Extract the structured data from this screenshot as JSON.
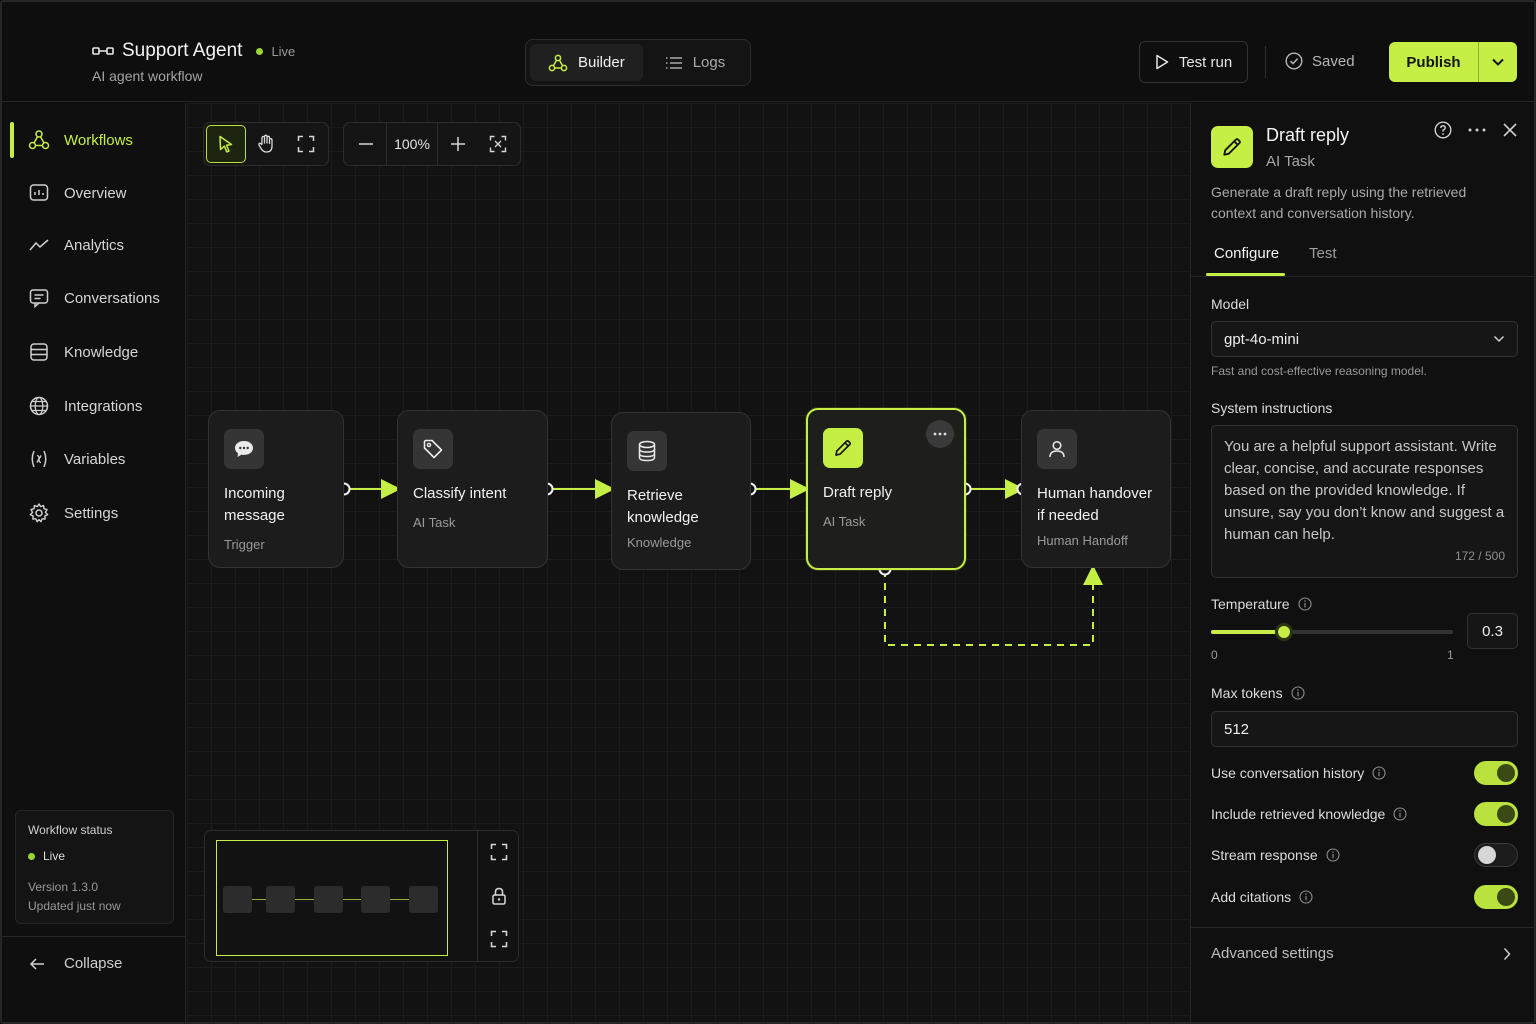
{
  "header": {
    "title": "Support Agent",
    "status": "Live",
    "subtitle": "AI agent workflow",
    "views": [
      {
        "label": "Builder",
        "active": true
      },
      {
        "label": "Logs",
        "active": false
      }
    ],
    "test_run_label": "Test run",
    "saved_label": "Saved",
    "publish_label": "Publish"
  },
  "sidebar": {
    "items": [
      {
        "label": "Workflows",
        "icon": "workflows-icon",
        "active": true
      },
      {
        "label": "Overview",
        "icon": "overview-icon",
        "active": false
      },
      {
        "label": "Analytics",
        "icon": "analytics-icon",
        "active": false
      },
      {
        "label": "Conversations",
        "icon": "conversations-icon",
        "active": false
      },
      {
        "label": "Knowledge",
        "icon": "knowledge-icon",
        "active": false
      },
      {
        "label": "Integrations",
        "icon": "globe-icon",
        "active": false
      },
      {
        "label": "Variables",
        "icon": "variables-icon",
        "active": false
      },
      {
        "label": "Settings",
        "icon": "gear-icon",
        "active": false
      }
    ],
    "status_card": {
      "title": "Workflow status",
      "status": "Live",
      "version": "Version 1.3.0",
      "updated": "Updated just now"
    },
    "collapse_label": "Collapse"
  },
  "canvas": {
    "zoom": "100%",
    "nodes": [
      {
        "title": "Incoming message",
        "type": "Trigger",
        "icon": "chat-bubble-icon"
      },
      {
        "title": "Classify intent",
        "type": "AI Task",
        "icon": "tag-icon"
      },
      {
        "title": "Retrieve knowledge",
        "type": "Knowledge",
        "icon": "database-icon"
      },
      {
        "title": "Draft reply",
        "type": "AI Task",
        "icon": "pencil-icon",
        "selected": true
      },
      {
        "title": "Human handover if needed",
        "type": "Human Handoff",
        "icon": "person-icon"
      }
    ]
  },
  "panel": {
    "title": "Draft reply",
    "type": "AI Task",
    "description": "Generate a draft reply using the retrieved context and conversation history.",
    "tabs": [
      {
        "label": "Configure",
        "active": true
      },
      {
        "label": "Test",
        "active": false
      }
    ],
    "model_label": "Model",
    "model_value": "gpt-4o-mini",
    "model_hint": "Fast and cost-effective reasoning model.",
    "instructions_label": "System instructions",
    "instructions_value": "You are a helpful support assistant. Write clear, concise, and accurate responses based on the provided knowledge. If unsure, say you don’t know and suggest a human can help.",
    "instructions_count": "172 / 500",
    "temperature_label": "Temperature",
    "temperature_value": "0.3",
    "temperature_fraction": 0.3,
    "temperature_min": "0",
    "temperature_max": "1",
    "max_tokens_label": "Max tokens",
    "max_tokens_value": "512",
    "toggles": [
      {
        "label": "Use conversation history",
        "on": true
      },
      {
        "label": "Include retrieved knowledge",
        "on": true
      },
      {
        "label": "Stream response",
        "on": false
      },
      {
        "label": "Add citations",
        "on": true
      }
    ],
    "advanced_label": "Advanced settings"
  },
  "colors": {
    "accent": "#c5ef45",
    "background": "#0e0e0e",
    "live": "#9bd433"
  }
}
